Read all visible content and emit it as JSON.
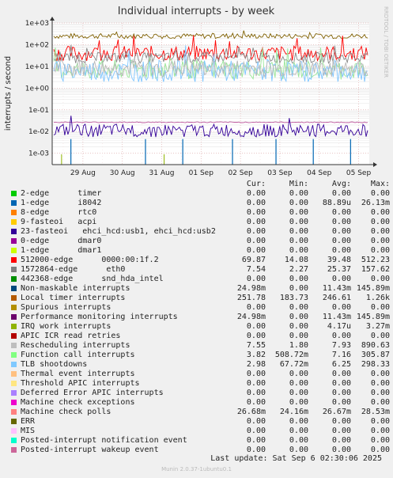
{
  "chart_data": {
    "type": "line",
    "title": "Individual interrupts - by week",
    "ylabel": "interrupts / second",
    "yscale": "log",
    "ylim": [
      0.0003,
      1000
    ],
    "yticks": [
      "1e+03",
      "1e+02",
      "1e+01",
      "1e+00",
      "1e-01",
      "1e-02",
      "1e-03"
    ],
    "ytick_values": [
      1000,
      100,
      10,
      1,
      0.1,
      0.01,
      0.001
    ],
    "xticks": [
      "29 Aug",
      "30 Aug",
      "31 Aug",
      "01 Sep",
      "02 Sep",
      "03 Sep",
      "04 Sep",
      "05 Sep"
    ],
    "grid": true,
    "series": [
      {
        "name": "Local timer interrupts",
        "color": "#7f5f00",
        "level": 250,
        "jitter": 0.12
      },
      {
        "name": "512000-edge      0000:00:1f.2",
        "color": "#ff0000",
        "level": 40,
        "jitter": 0.35
      },
      {
        "name": "1572864-edge      eth0",
        "color": "#888888",
        "level": 25,
        "jitter": 0.25
      },
      {
        "name": "Function call interrupts",
        "color": "#99e699",
        "level": 7,
        "jitter": 0.45
      },
      {
        "name": "TLB shootdowns",
        "color": "#7fc5ff",
        "level": 6,
        "jitter": 0.5
      },
      {
        "name": "Rescheduling interrupts",
        "color": "#b8b8b8",
        "level": 8,
        "jitter": 0.4
      },
      {
        "name": "Machine check polls",
        "color": "#bd5a9e",
        "level": 0.0267,
        "jitter": 0.02
      },
      {
        "name": "Non-maskable interrupts",
        "color": "#330099",
        "level": 0.011,
        "jitter": 0.3
      }
    ]
  },
  "side_label": "RRDTOOL / TOBI OETIKER",
  "legend": {
    "headers": [
      "Cur:",
      "Min:",
      "Avg:",
      "Max:"
    ],
    "rows": [
      {
        "name": "2-edge      timer",
        "color": "#00cc00",
        "cur": "0.00",
        "min": "0.00",
        "avg": "0.00",
        "max": "0.00"
      },
      {
        "name": "1-edge      i8042",
        "color": "#0066b3",
        "cur": "0.00",
        "min": "0.00",
        "avg": "88.89u",
        "max": "26.13m"
      },
      {
        "name": "8-edge      rtc0",
        "color": "#ff8000",
        "cur": "0.00",
        "min": "0.00",
        "avg": "0.00",
        "max": "0.00"
      },
      {
        "name": "9-fasteoi   acpi",
        "color": "#ffcc00",
        "cur": "0.00",
        "min": "0.00",
        "avg": "0.00",
        "max": "0.00"
      },
      {
        "name": "23-fasteoi   ehci_hcd:usb1, ehci_hcd:usb2",
        "color": "#330099",
        "cur": "0.00",
        "min": "0.00",
        "avg": "0.00",
        "max": "0.00"
      },
      {
        "name": "0-edge      dmar0",
        "color": "#990099",
        "cur": "0.00",
        "min": "0.00",
        "avg": "0.00",
        "max": "0.00"
      },
      {
        "name": "1-edge      dmar1",
        "color": "#ccff00",
        "cur": "0.00",
        "min": "0.00",
        "avg": "0.00",
        "max": "0.00"
      },
      {
        "name": "512000-edge      0000:00:1f.2",
        "color": "#ff0000",
        "cur": "69.87",
        "min": "14.08",
        "avg": "39.48",
        "max": "512.23"
      },
      {
        "name": "1572864-edge      eth0",
        "color": "#808080",
        "cur": "7.54",
        "min": "2.27",
        "avg": "25.37",
        "max": "157.62"
      },
      {
        "name": "442368-edge      snd_hda_intel",
        "color": "#008f00",
        "cur": "0.00",
        "min": "0.00",
        "avg": "0.00",
        "max": "0.00"
      },
      {
        "name": "Non-maskable interrupts",
        "color": "#00487d",
        "cur": "24.98m",
        "min": "0.00",
        "avg": "11.43m",
        "max": "145.89m"
      },
      {
        "name": "Local timer interrupts",
        "color": "#b35a00",
        "cur": "251.78",
        "min": "183.73",
        "avg": "246.61",
        "max": "1.26k"
      },
      {
        "name": "Spurious interrupts",
        "color": "#b38f00",
        "cur": "0.00",
        "min": "0.00",
        "avg": "0.00",
        "max": "0.00"
      },
      {
        "name": "Performance monitoring interrupts",
        "color": "#6b006b",
        "cur": "24.98m",
        "min": "0.00",
        "avg": "11.43m",
        "max": "145.89m"
      },
      {
        "name": "IRQ work interrupts",
        "color": "#8fb300",
        "cur": "0.00",
        "min": "0.00",
        "avg": "4.17u",
        "max": "3.27m"
      },
      {
        "name": "APIC ICR read retries",
        "color": "#b30000",
        "cur": "0.00",
        "min": "0.00",
        "avg": "0.00",
        "max": "0.00"
      },
      {
        "name": "Rescheduling interrupts",
        "color": "#bebebe",
        "cur": "7.55",
        "min": "1.80",
        "avg": "7.93",
        "max": "890.63"
      },
      {
        "name": "Function call interrupts",
        "color": "#80ff80",
        "cur": "3.82",
        "min": "508.72m",
        "avg": "7.16",
        "max": "305.87"
      },
      {
        "name": "TLB shootdowns",
        "color": "#80c9ff",
        "cur": "2.98",
        "min": "67.72m",
        "avg": "6.25",
        "max": "298.33"
      },
      {
        "name": "Thermal event interrupts",
        "color": "#ffc080",
        "cur": "0.00",
        "min": "0.00",
        "avg": "0.00",
        "max": "0.00"
      },
      {
        "name": "Threshold APIC interrupts",
        "color": "#ffe680",
        "cur": "0.00",
        "min": "0.00",
        "avg": "0.00",
        "max": "0.00"
      },
      {
        "name": "Deferred Error APIC interrupts",
        "color": "#aa80ff",
        "cur": "0.00",
        "min": "0.00",
        "avg": "0.00",
        "max": "0.00"
      },
      {
        "name": "Machine check exceptions",
        "color": "#ee00cc",
        "cur": "0.00",
        "min": "0.00",
        "avg": "0.00",
        "max": "0.00"
      },
      {
        "name": "Machine check polls",
        "color": "#ff8080",
        "cur": "26.68m",
        "min": "24.16m",
        "avg": "26.67m",
        "max": "28.53m"
      },
      {
        "name": "ERR",
        "color": "#666600",
        "cur": "0.00",
        "min": "0.00",
        "avg": "0.00",
        "max": "0.00"
      },
      {
        "name": "MIS",
        "color": "#ffbfff",
        "cur": "0.00",
        "min": "0.00",
        "avg": "0.00",
        "max": "0.00"
      },
      {
        "name": "Posted-interrupt notification event",
        "color": "#00ffcc",
        "cur": "0.00",
        "min": "0.00",
        "avg": "0.00",
        "max": "0.00"
      },
      {
        "name": "Posted-interrupt wakeup event",
        "color": "#cc6699",
        "cur": "0.00",
        "min": "0.00",
        "avg": "0.00",
        "max": "0.00"
      }
    ]
  },
  "footer": {
    "last_update": "Last update: Sat Sep  6 02:30:06 2025",
    "munin": "Munin 2.0.37-1ubuntu0.1"
  }
}
